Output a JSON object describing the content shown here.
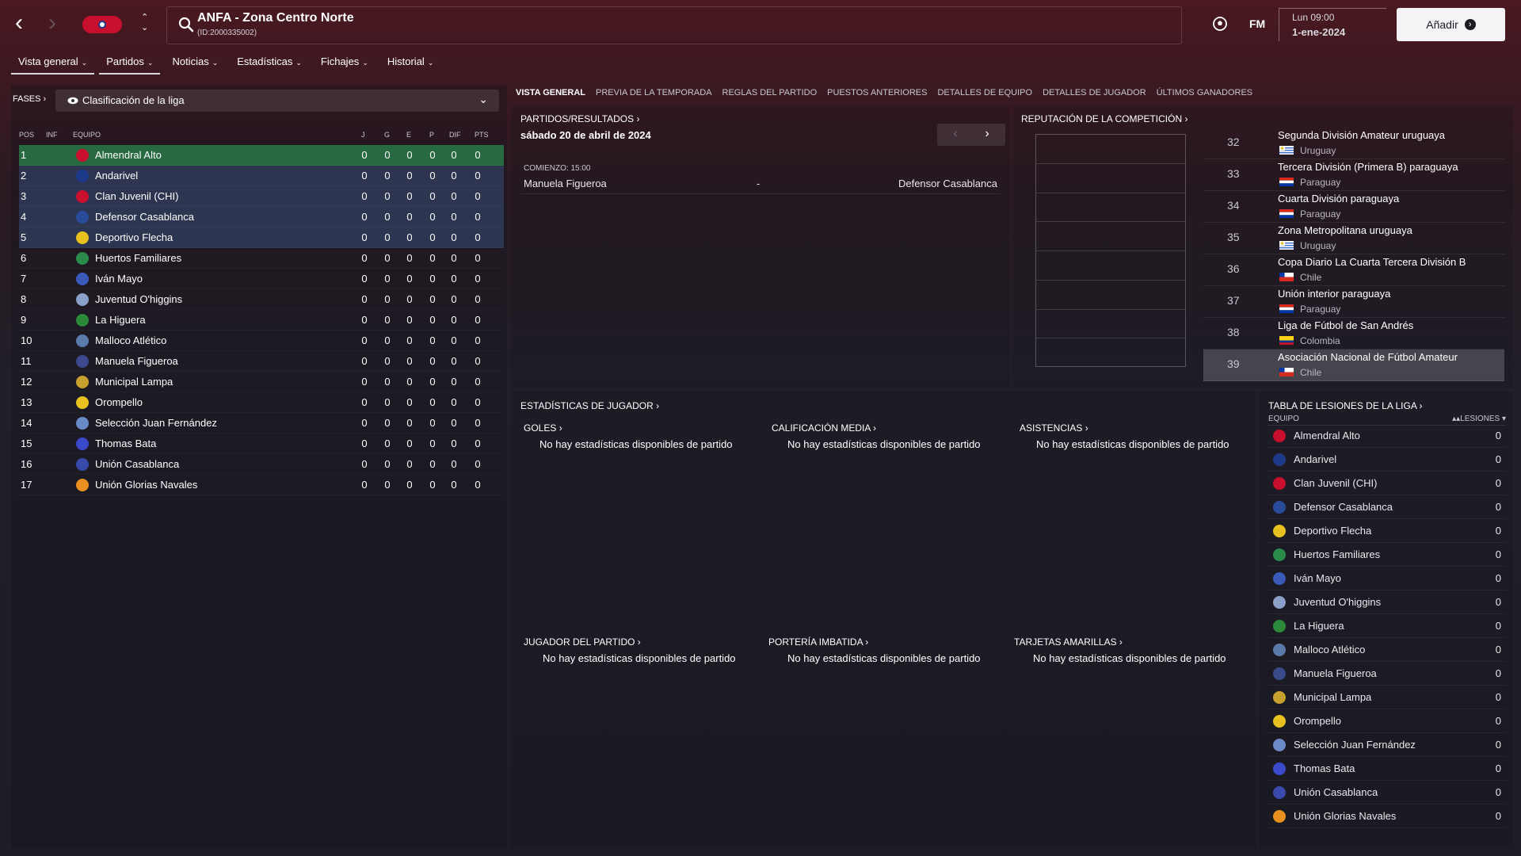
{
  "header": {
    "title": "ANFA - Zona Centro Norte",
    "subtitle": "(ID:2000335002)",
    "day": "Lun 09:00",
    "date": "1-ene-2024",
    "add_label": "Añadir",
    "fm_label": "FM"
  },
  "menu": [
    {
      "label": "Vista general",
      "active": true
    },
    {
      "label": "Partidos",
      "active": true
    },
    {
      "label": "Noticias",
      "active": false
    },
    {
      "label": "Estadísticas",
      "active": false
    },
    {
      "label": "Fichajes",
      "active": false
    },
    {
      "label": "Historial",
      "active": false
    }
  ],
  "left": {
    "phases_label": "FASES",
    "stage": "Clasificación de la liga",
    "columns": {
      "pos": "POS",
      "inf": "INF",
      "team": "EQUIPO",
      "j": "J",
      "g": "G",
      "e": "E",
      "p": "P",
      "dif": "DIF",
      "pts": "PTS"
    },
    "rows": [
      {
        "pos": "1",
        "team": "Almendral Alto",
        "j": "0",
        "g": "0",
        "e": "0",
        "p": "0",
        "dif": "0",
        "pts": "0",
        "color": "#c8102e"
      },
      {
        "pos": "2",
        "team": "Andarivel",
        "j": "0",
        "g": "0",
        "e": "0",
        "p": "0",
        "dif": "0",
        "pts": "0",
        "color": "#1d3a8a"
      },
      {
        "pos": "3",
        "team": "Clan Juvenil (CHI)",
        "j": "0",
        "g": "0",
        "e": "0",
        "p": "0",
        "dif": "0",
        "pts": "0",
        "color": "#c8102e"
      },
      {
        "pos": "4",
        "team": "Defensor Casablanca",
        "j": "0",
        "g": "0",
        "e": "0",
        "p": "0",
        "dif": "0",
        "pts": "0",
        "color": "#2a4a9a"
      },
      {
        "pos": "5",
        "team": "Deportivo Flecha",
        "j": "0",
        "g": "0",
        "e": "0",
        "p": "0",
        "dif": "0",
        "pts": "0",
        "color": "#e8c020"
      },
      {
        "pos": "6",
        "team": "Huertos Familiares",
        "j": "0",
        "g": "0",
        "e": "0",
        "p": "0",
        "dif": "0",
        "pts": "0",
        "color": "#2a8a4a"
      },
      {
        "pos": "7",
        "team": "Iván Mayo",
        "j": "0",
        "g": "0",
        "e": "0",
        "p": "0",
        "dif": "0",
        "pts": "0",
        "color": "#3a5aba"
      },
      {
        "pos": "8",
        "team": "Juventud O'higgins",
        "j": "0",
        "g": "0",
        "e": "0",
        "p": "0",
        "dif": "0",
        "pts": "0",
        "color": "#8aa0c8"
      },
      {
        "pos": "9",
        "team": "La Higuera",
        "j": "0",
        "g": "0",
        "e": "0",
        "p": "0",
        "dif": "0",
        "pts": "0",
        "color": "#2a8a3a"
      },
      {
        "pos": "10",
        "team": "Malloco Atlético",
        "j": "0",
        "g": "0",
        "e": "0",
        "p": "0",
        "dif": "0",
        "pts": "0",
        "color": "#5a7aaa"
      },
      {
        "pos": "11",
        "team": "Manuela Figueroa",
        "j": "0",
        "g": "0",
        "e": "0",
        "p": "0",
        "dif": "0",
        "pts": "0",
        "color": "#3a4a8a"
      },
      {
        "pos": "12",
        "team": "Municipal Lampa",
        "j": "0",
        "g": "0",
        "e": "0",
        "p": "0",
        "dif": "0",
        "pts": "0",
        "color": "#c8a030"
      },
      {
        "pos": "13",
        "team": "Orompello",
        "j": "0",
        "g": "0",
        "e": "0",
        "p": "0",
        "dif": "0",
        "pts": "0",
        "color": "#e8c020"
      },
      {
        "pos": "14",
        "team": "Selección Juan Fernández",
        "j": "0",
        "g": "0",
        "e": "0",
        "p": "0",
        "dif": "0",
        "pts": "0",
        "color": "#6a8ac8"
      },
      {
        "pos": "15",
        "team": "Thomas Bata",
        "j": "0",
        "g": "0",
        "e": "0",
        "p": "0",
        "dif": "0",
        "pts": "0",
        "color": "#3a4aca"
      },
      {
        "pos": "16",
        "team": "Unión Casablanca",
        "j": "0",
        "g": "0",
        "e": "0",
        "p": "0",
        "dif": "0",
        "pts": "0",
        "color": "#3a4aaa"
      },
      {
        "pos": "17",
        "team": "Unión Glorias Navales",
        "j": "0",
        "g": "0",
        "e": "0",
        "p": "0",
        "dif": "0",
        "pts": "0",
        "color": "#e89020"
      }
    ]
  },
  "subtabs": [
    {
      "label": "VISTA GENERAL",
      "active": true
    },
    {
      "label": "PREVIA DE LA TEMPORADA",
      "active": false
    },
    {
      "label": "REGLAS DEL PARTIDO",
      "active": false
    },
    {
      "label": "PUESTOS ANTERIORES",
      "active": false
    },
    {
      "label": "DETALLES DE EQUIPO",
      "active": false
    },
    {
      "label": "DETALLES DE JUGADOR",
      "active": false
    },
    {
      "label": "ÚLTIMOS GANADORES",
      "active": false
    }
  ],
  "results": {
    "title": "PARTIDOS/RESULTADOS",
    "date": "sábado 20 de abril de 2024",
    "kickoff": "COMIENZO: 15:00",
    "home": "Manuela Figueroa",
    "sep": "-",
    "away": "Defensor Casablanca"
  },
  "reputation": {
    "title": "REPUTACIÓN DE LA COMPETICIÓN",
    "rows": [
      {
        "rank": "32",
        "name": "Segunda División Amateur uruguaya",
        "country": "Uruguay",
        "flag": "uruguay"
      },
      {
        "rank": "33",
        "name": "Tercera División (Primera B) paraguaya",
        "country": "Paraguay",
        "flag": "paraguay"
      },
      {
        "rank": "34",
        "name": "Cuarta División paraguaya",
        "country": "Paraguay",
        "flag": "paraguay"
      },
      {
        "rank": "35",
        "name": "Zona Metropolitana uruguaya",
        "country": "Uruguay",
        "flag": "uruguay"
      },
      {
        "rank": "36",
        "name": "Copa Diario La Cuarta Tercera División B",
        "country": "Chile",
        "flag": "chile"
      },
      {
        "rank": "37",
        "name": "Unión interior paraguaya",
        "country": "Paraguay",
        "flag": "paraguay"
      },
      {
        "rank": "38",
        "name": "Liga de Fútbol de San Andrés",
        "country": "Colombia",
        "flag": "colombia"
      },
      {
        "rank": "39",
        "name": "Asociación Nacional de Fútbol Amateur",
        "country": "Chile",
        "flag": "chile",
        "selected": true
      }
    ]
  },
  "player_stats": {
    "title": "ESTADÍSTICAS DE JUGADOR",
    "empty": "No hay estadísticas disponibles de partido",
    "goals": "GOLES",
    "rating": "CALIFICACIÓN MEDIA",
    "assists": "ASISTENCIAS",
    "pom": "JUGADOR DEL PARTIDO",
    "clean_sheets": "PORTERÍA IMBATIDA",
    "yellow": "TARJETAS AMARILLAS"
  },
  "injuries": {
    "title": "TABLA DE LESIONES DE LA LIGA",
    "col_team": "EQUIPO",
    "col_inj": "LESIONES",
    "rows": [
      {
        "team": "Almendral Alto",
        "value": "0"
      },
      {
        "team": "Andarivel",
        "value": "0"
      },
      {
        "team": "Clan Juvenil (CHI)",
        "value": "0"
      },
      {
        "team": "Defensor Casablanca",
        "value": "0"
      },
      {
        "team": "Deportivo Flecha",
        "value": "0"
      },
      {
        "team": "Huertos Familiares",
        "value": "0"
      },
      {
        "team": "Iván Mayo",
        "value": "0"
      },
      {
        "team": "Juventud O'higgins",
        "value": "0"
      },
      {
        "team": "La Higuera",
        "value": "0"
      },
      {
        "team": "Malloco Atlético",
        "value": "0"
      },
      {
        "team": "Manuela Figueroa",
        "value": "0"
      },
      {
        "team": "Municipal Lampa",
        "value": "0"
      },
      {
        "team": "Orompello",
        "value": "0"
      },
      {
        "team": "Selección Juan Fernández",
        "value": "0"
      },
      {
        "team": "Thomas Bata",
        "value": "0"
      },
      {
        "team": "Unión Casablanca",
        "value": "0"
      },
      {
        "team": "Unión Glorias Navales",
        "value": "0"
      }
    ]
  }
}
